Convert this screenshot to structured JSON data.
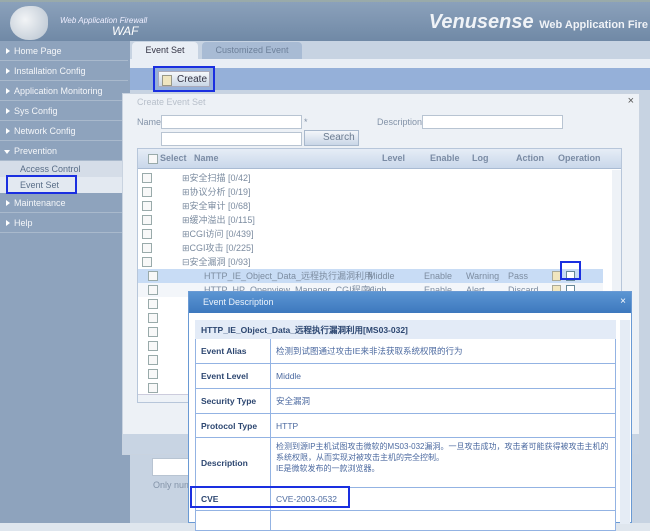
{
  "header": {
    "subtitle": "Web Application Firewall",
    "product": "WAF",
    "brand": "Venusense",
    "brand_suffix": "Web Application Fire"
  },
  "sidebar": {
    "items": [
      {
        "label": "Home Page"
      },
      {
        "label": "Installation Config"
      },
      {
        "label": "Application Monitoring"
      },
      {
        "label": "Sys Config"
      },
      {
        "label": "Network Config"
      },
      {
        "label": "Prevention"
      },
      {
        "label": "Maintenance"
      },
      {
        "label": "Help"
      }
    ],
    "subitems": [
      {
        "label": "Access Control"
      },
      {
        "label": "Event Set"
      }
    ]
  },
  "tabs": [
    {
      "label": "Event Set"
    },
    {
      "label": "Customized Event"
    }
  ],
  "toolbar": {
    "create_label": "Create"
  },
  "create_dialog": {
    "title": "Create Event Set",
    "close": "×",
    "name_label": "Name",
    "required_mark": "*",
    "description_label": "Description",
    "search_label": "Search",
    "footer_hint": "Only num",
    "columns": [
      "Select",
      "Name",
      "Level",
      "Enable",
      "Log",
      "Action",
      "Operation"
    ],
    "groups": [
      "⊞安全扫描 [0/42]",
      "⊞协议分析 [0/19]",
      "⊞安全审计 [0/68]",
      "⊞缓冲溢出 [0/115]",
      "⊞CGI访问 [0/439]",
      "⊞CGI攻击 [0/225]",
      "⊟安全漏洞 [0/93]"
    ],
    "rows": [
      {
        "name": "HTTP_IE_Object_Data_远程执行漏洞利用",
        "level": "Middle",
        "enable": "Enable",
        "log": "Warning",
        "action": "Pass"
      },
      {
        "name": "HTTP_HP_Openview_Manager_CGI程序O",
        "level": "High",
        "enable": "Enable",
        "log": "Alert",
        "action": "Discard"
      }
    ]
  },
  "event_dialog": {
    "title": "Event Description",
    "close": "×",
    "heading": "HTTP_IE_Object_Data_远程执行漏洞利用[MS03-032]",
    "fields": [
      {
        "key": "Event Alias",
        "value": "检测到试图通过攻击IE来非法获取系统权限的行为"
      },
      {
        "key": "Event Level",
        "value": "Middle"
      },
      {
        "key": "Security Type",
        "value": "安全漏洞"
      },
      {
        "key": "Protocol Type",
        "value": "HTTP"
      },
      {
        "key": "Description",
        "value": "检测到源IP主机试图攻击微软的MS03-032漏洞。一旦攻击成功，攻击者可能获得被攻击主机的系统权限，从而实现对被攻击主机的完全控制。\nIE是微软发布的一款浏览器。"
      },
      {
        "key": "CVE",
        "value": "CVE-2003-0532"
      }
    ]
  }
}
